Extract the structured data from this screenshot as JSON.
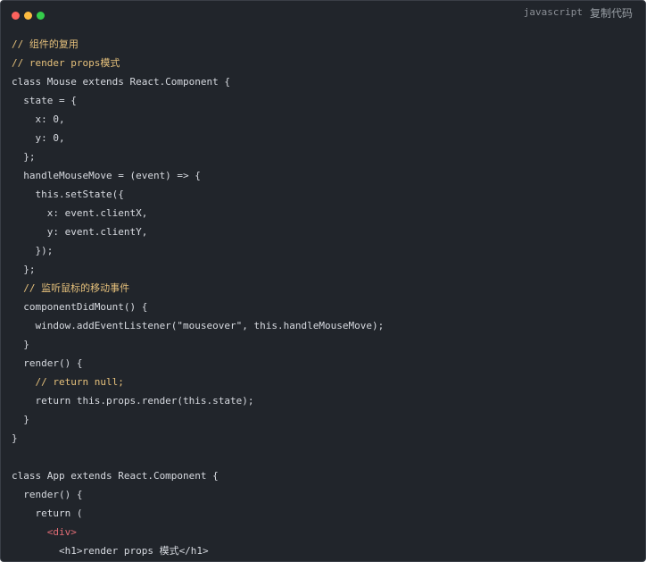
{
  "header": {
    "language": "javascript",
    "copy_label": "复制代码"
  },
  "code_lines": [
    "// 组件的复用",
    "// render props模式",
    "class Mouse extends React.Component {",
    "  state = {",
    "    x: 0,",
    "    y: 0,",
    "  };",
    "  handleMouseMove = (event) => {",
    "    this.setState({",
    "      x: event.clientX,",
    "      y: event.clientY,",
    "    });",
    "  };",
    "  // 监听鼠标的移动事件",
    "  componentDidMount() {",
    "    window.addEventListener(\"mouseover\", this.handleMouseMove);",
    "  }",
    "  render() {",
    "    // return null;",
    "    return this.props.render(this.state);",
    "  }",
    "}",
    "",
    "class App extends React.Component {",
    "  render() {",
    "    return (",
    "      <div>",
    "        <h1>render props 模式</h1>"
  ],
  "colors": {
    "background": "#21252b",
    "comment": "#e5c07b",
    "keyword": "#c678dd",
    "string": "#61afef",
    "tag": "#e06c75",
    "number": "#d19a66",
    "function": "#98c379"
  }
}
